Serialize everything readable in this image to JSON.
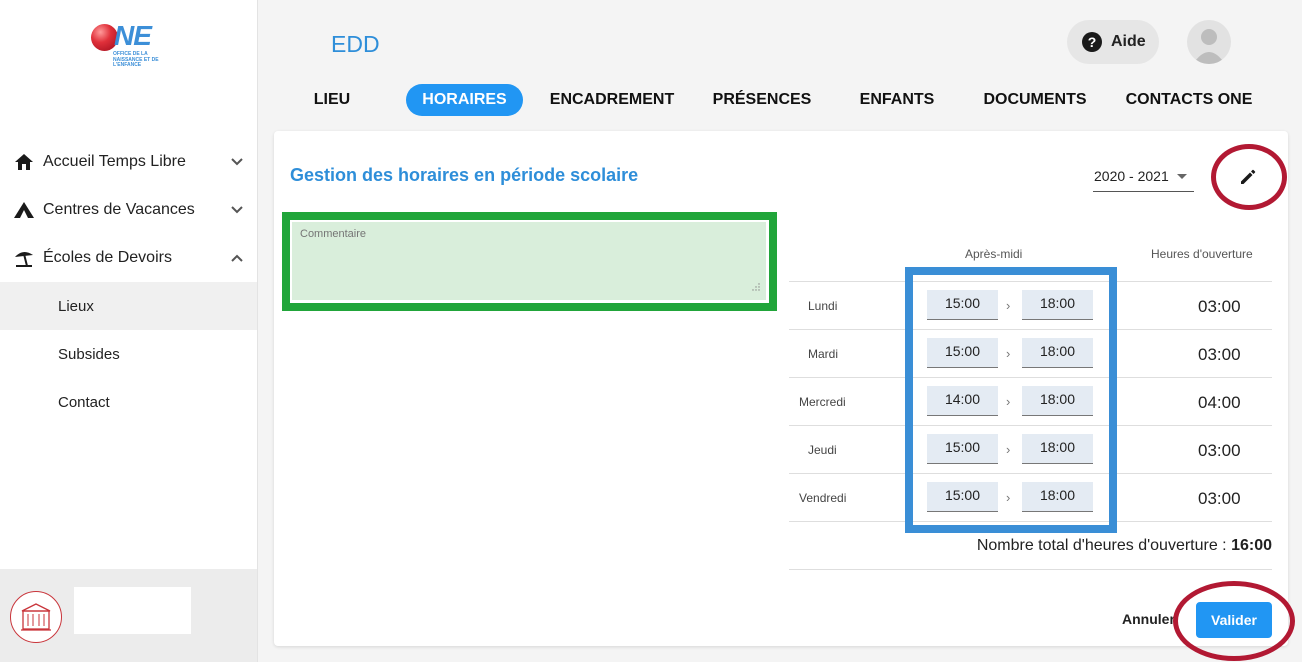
{
  "logo": {
    "text": "NE",
    "subtitle": "OFFICE DE LA NAISSANCE ET DE L'ENFANCE"
  },
  "sidebar": {
    "items": [
      {
        "label": "Accueil Temps Libre",
        "icon": "house-icon",
        "expanded": false
      },
      {
        "label": "Centres de Vacances",
        "icon": "tent-icon",
        "expanded": false
      },
      {
        "label": "Écoles de Devoirs",
        "icon": "beach-umbrella-icon",
        "expanded": true
      }
    ],
    "subitems": [
      {
        "label": "Lieux",
        "active": true
      },
      {
        "label": "Subsides",
        "active": false
      },
      {
        "label": "Contact",
        "active": false
      }
    ]
  },
  "header": {
    "title": "EDD",
    "help_label": "Aide"
  },
  "tabs": [
    {
      "label": "LIEU",
      "active": false
    },
    {
      "label": "HORAIRES",
      "active": true
    },
    {
      "label": "ENCADREMENT",
      "active": false
    },
    {
      "label": "PRÉSENCES",
      "active": false
    },
    {
      "label": "ENFANTS",
      "active": false
    },
    {
      "label": "DOCUMENTS",
      "active": false
    },
    {
      "label": "CONTACTS ONE",
      "active": false
    }
  ],
  "card": {
    "title": "Gestion des horaires en période scolaire",
    "year": "2020 - 2021",
    "comment_placeholder": "Commentaire",
    "columns": {
      "afternoon": "Après-midi",
      "opening_hours": "Heures d'ouverture"
    },
    "rows": [
      {
        "day": "Lundi",
        "start": "15:00",
        "end": "18:00",
        "hours": "03:00"
      },
      {
        "day": "Mardi",
        "start": "15:00",
        "end": "18:00",
        "hours": "03:00"
      },
      {
        "day": "Mercredi",
        "start": "14:00",
        "end": "18:00",
        "hours": "04:00"
      },
      {
        "day": "Jeudi",
        "start": "15:00",
        "end": "18:00",
        "hours": "03:00"
      },
      {
        "day": "Vendredi",
        "start": "15:00",
        "end": "18:00",
        "hours": "03:00"
      }
    ],
    "arrow": "›",
    "total_label": "Nombre total d'heures d'ouverture :",
    "total_value": "16:00",
    "cancel_label": "Annuler",
    "validate_label": "Valider"
  },
  "colors": {
    "accent": "#2196f3",
    "title_blue": "#2e8ed9",
    "highlight_green": "#21a53a",
    "highlight_blue": "#3a8ed6",
    "highlight_red": "#b21933"
  }
}
